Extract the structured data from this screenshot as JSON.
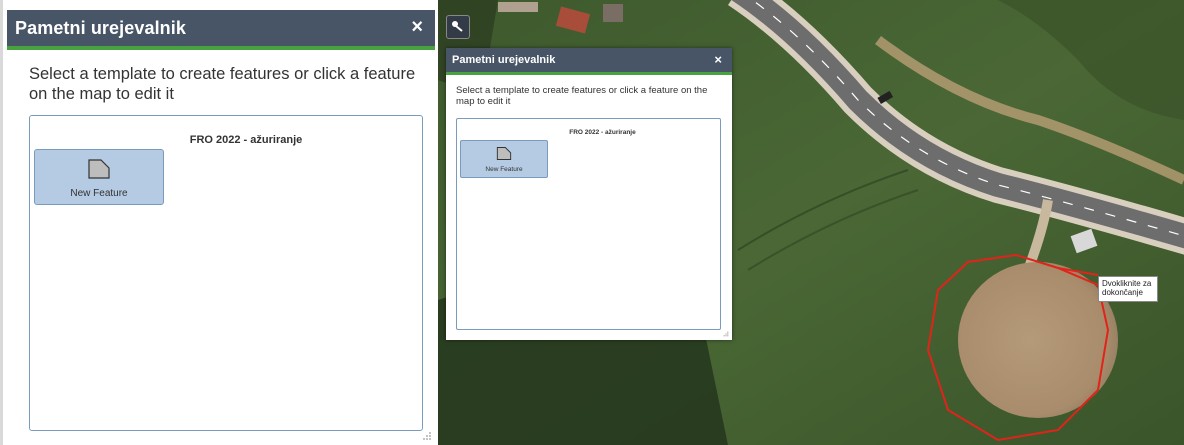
{
  "widget": {
    "title": "Pametni urejevalnik",
    "close_glyph": "×",
    "instructions": "Select a template to create features or click a feature on the map to edit it",
    "layer_title": "FRO 2022 - ažuriranje",
    "templates": [
      {
        "label": "New Feature",
        "icon": "polygon-icon"
      }
    ]
  },
  "map": {
    "tooltip": "Dvokliknite za dokončanje",
    "sketch_color": "#e2231a"
  },
  "colors": {
    "header_bg": "#485566",
    "header_accent": "#48a23f",
    "template_bg": "#b5cbe3",
    "template_border": "#7a9cbc"
  }
}
